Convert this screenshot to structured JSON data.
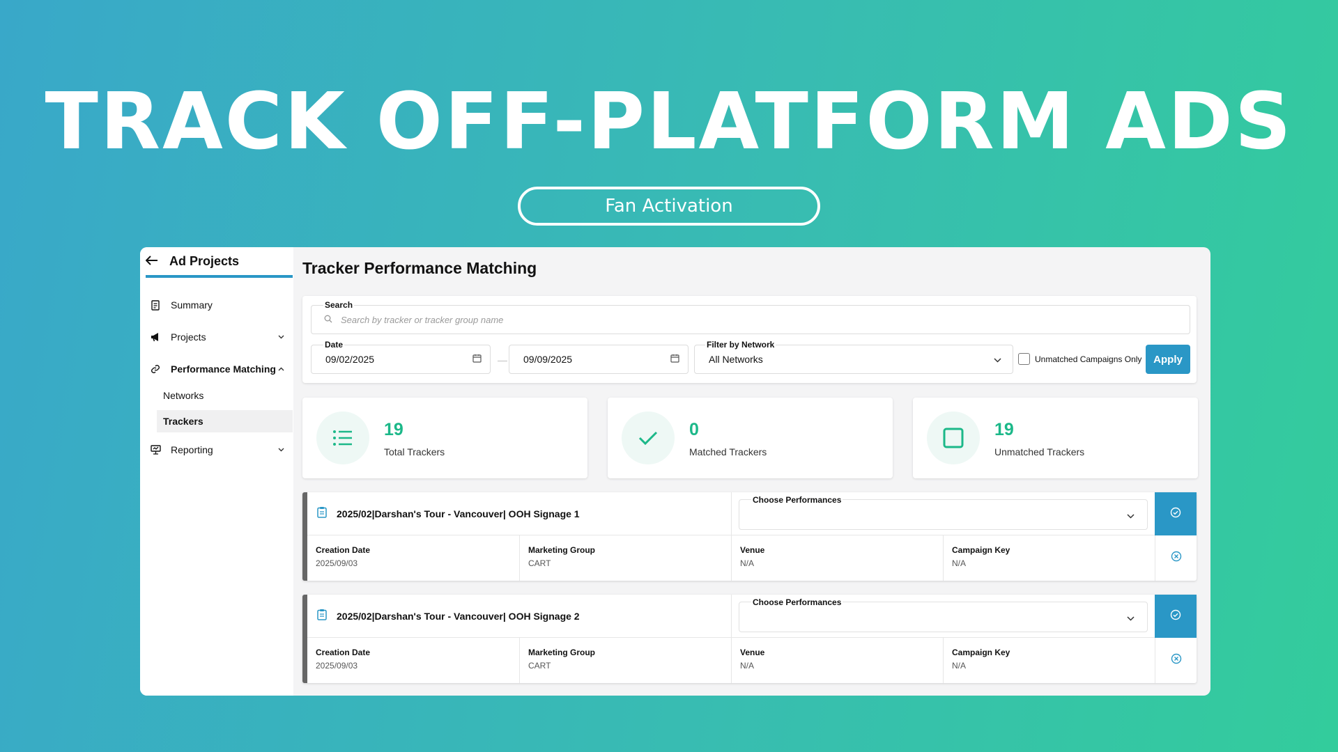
{
  "hero": {
    "title": "TRACK OFF-PLATFORM ADS",
    "pill": "Fan Activation"
  },
  "sidebar": {
    "back_icon": "arrow-left-icon",
    "title": "Ad Projects",
    "items": [
      {
        "label": "Summary",
        "icon": "report-icon"
      },
      {
        "label": "Projects",
        "icon": "megaphone-icon",
        "chevron": "down"
      },
      {
        "label": "Performance Matching",
        "icon": "link-icon",
        "chevron": "up",
        "expanded": true,
        "children": [
          {
            "label": "Networks",
            "active": false
          },
          {
            "label": "Trackers",
            "active": true
          }
        ]
      },
      {
        "label": "Reporting",
        "icon": "presentation-icon",
        "chevron": "down"
      }
    ]
  },
  "main": {
    "title": "Tracker Performance Matching",
    "filters": {
      "search_label": "Search",
      "search_placeholder": "Search by tracker or tracker group name",
      "date_label": "Date",
      "date_from": "09/02/2025",
      "date_to": "09/09/2025",
      "network_label": "Filter by Network",
      "network_value": "All Networks",
      "unmatched_label": "Unmatched Campaigns Only",
      "unmatched_checked": false,
      "apply_label": "Apply"
    },
    "stats": [
      {
        "value": "19",
        "label": "Total Trackers",
        "icon": "list-icon"
      },
      {
        "value": "0",
        "label": "Matched Trackers",
        "icon": "check-icon"
      },
      {
        "value": "19",
        "label": "Unmatched Trackers",
        "icon": "square-icon"
      }
    ],
    "trackers": [
      {
        "name": "2025/02|Darshan's Tour - Vancouver| OOH Signage 1",
        "choose_label": "Choose Performances",
        "fields": [
          {
            "key": "Creation Date",
            "value": "2025/09/03"
          },
          {
            "key": "Marketing Group",
            "value": "CART"
          },
          {
            "key": "Venue",
            "value": "N/A"
          },
          {
            "key": "Campaign Key",
            "value": "N/A"
          }
        ]
      },
      {
        "name": "2025/02|Darshan's Tour - Vancouver| OOH Signage 2",
        "choose_label": "Choose Performances",
        "fields": [
          {
            "key": "Creation Date",
            "value": "2025/09/03"
          },
          {
            "key": "Marketing Group",
            "value": "CART"
          },
          {
            "key": "Venue",
            "value": "N/A"
          },
          {
            "key": "Campaign Key",
            "value": "N/A"
          }
        ]
      }
    ]
  },
  "colors": {
    "accent": "#2a97c6",
    "stat_green": "#1cb889"
  }
}
